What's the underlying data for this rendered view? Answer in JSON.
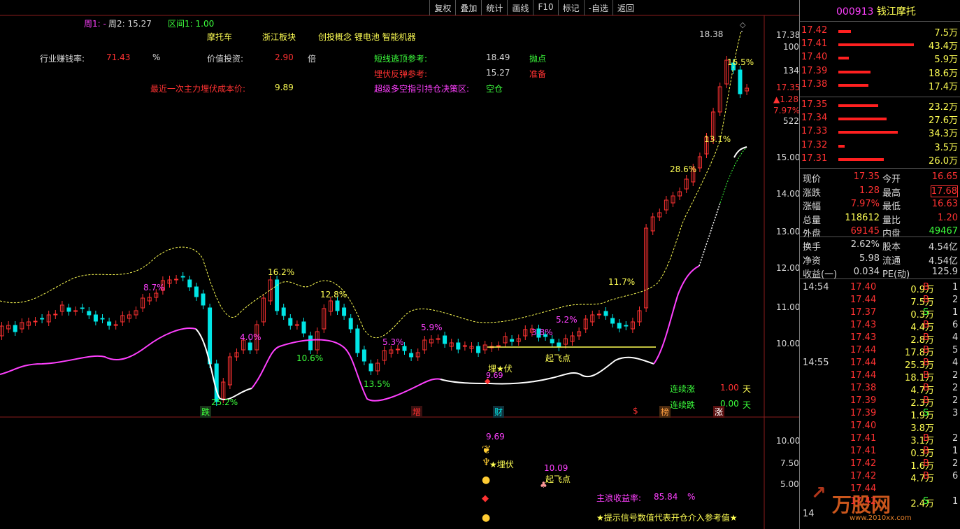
{
  "header": {
    "week1": "周1: -",
    "week2": "周2: 15.27",
    "range1": "区间1: 1.00"
  },
  "toolbar": [
    "复权",
    "叠加",
    "统计",
    "画线",
    "F10",
    "标记",
    "-自选",
    "返回"
  ],
  "info": {
    "tag1": "摩托车",
    "tag2": "浙江板块",
    "tag3": "创投概念 锂电池 智能机器",
    "industry_label": "行业赚钱率:",
    "industry_value": "71.43",
    "industry_unit": "%",
    "value_label": "价值投资:",
    "value_value": "2.90",
    "value_unit": "倍",
    "cost_label": "最近一次主力埋伏成本价:",
    "cost_value": "9.89",
    "short_top_label": "短线逃顶参考:",
    "short_top_value": "18.49",
    "short_top_action": "抛点",
    "rebound_label": "埋伏反弹参考:",
    "rebound_value": "15.27",
    "rebound_action": "准备",
    "super_label": "超级多空指引持仓决策区:",
    "super_value": "空仓",
    "consec_up_label": "连续涨",
    "consec_up_value": "1.00",
    "consec_up_unit": "天",
    "consec_down_label": "连续跌",
    "consec_down_value": "0.00",
    "consec_down_unit": "天"
  },
  "annotations": {
    "p87": "8.7%",
    "p162": "16.2%",
    "p128": "12.8%",
    "p40": "4.0%",
    "p106": "10.6%",
    "p53": "5.3%",
    "p135": "13.5%",
    "p59": "5.9%",
    "p38": "3.8%",
    "p52": "5.2%",
    "p117": "11.7%",
    "p286": "28.6%",
    "p131": "13.1%",
    "p165": "16.5%",
    "p252": "25.2%",
    "high_label": "18.38",
    "maifu": "埋★伏",
    "maifu_val": "9.69",
    "qifei": "起飞点",
    "sig_die": "跌",
    "sig_zeng": "增",
    "sig_cai": "财",
    "sig_s": "$",
    "sig_bang": "榜",
    "sig_zhang": "涨"
  },
  "price_axis": [
    "17.38",
    "100",
    "134",
    "17.35",
    "▲1.28",
    "7.97%",
    "522",
    "15.00",
    "14.00",
    "13.00",
    "12.00",
    "11.00",
    "10.00"
  ],
  "lower_axis": [
    "10.00",
    "7.50",
    "5.00"
  ],
  "lower": {
    "val1": "9.69",
    "maifu": "★埋伏",
    "val2": "10.09",
    "qifei": "起飞点",
    "profit_label": "主浪收益率:",
    "profit_value": "85.84",
    "profit_unit": "%",
    "note": "★提示信号数值代表开仓介入参考值★",
    "watermark": "万股网",
    "watermark_url": "www.2010xx.com"
  },
  "quote": {
    "code": "000913",
    "name": "钱江摩托",
    "asks": [
      {
        "price": "17.42",
        "vol": "7.5万",
        "ratio": 0.17
      },
      {
        "price": "17.41",
        "vol": "43.4万",
        "ratio": 1.0
      },
      {
        "price": "17.40",
        "vol": "5.9万",
        "ratio": 0.14
      },
      {
        "price": "17.39",
        "vol": "18.6万",
        "ratio": 0.43
      },
      {
        "price": "17.38",
        "vol": "17.4万",
        "ratio": 0.4
      }
    ],
    "bids": [
      {
        "price": "17.35",
        "vol": "23.2万",
        "ratio": 0.53
      },
      {
        "price": "17.34",
        "vol": "27.6万",
        "ratio": 0.64
      },
      {
        "price": "17.33",
        "vol": "34.3万",
        "ratio": 0.79
      },
      {
        "price": "17.32",
        "vol": "3.5万",
        "ratio": 0.08
      },
      {
        "price": "17.31",
        "vol": "26.0万",
        "ratio": 0.6
      }
    ],
    "stats": [
      [
        "现价",
        "17.35",
        "今开",
        "16.65"
      ],
      [
        "涨跌",
        "1.28",
        "最高",
        "17.68"
      ],
      [
        "涨幅",
        "7.97%",
        "最低",
        "16.63"
      ],
      [
        "总量",
        "118612",
        "量比",
        "1.20"
      ],
      [
        "外盘",
        "69145",
        "内盘",
        "49467"
      ]
    ],
    "stats2": [
      [
        "换手",
        "2.62%",
        "股本",
        "4.54亿"
      ],
      [
        "净资",
        "5.98",
        "流通",
        "4.54亿"
      ],
      [
        "收益(一)",
        "0.034",
        "PE(动)",
        "125.9"
      ]
    ],
    "ticks1_time": "14:54",
    "ticks1": [
      [
        "17.40",
        "0.9万",
        "B",
        "1"
      ],
      [
        "17.44",
        "7.5万",
        "B",
        "2"
      ],
      [
        "17.37",
        "0.3万",
        "S",
        "1"
      ],
      [
        "17.43",
        "4.4万",
        "B",
        "6"
      ],
      [
        "17.43",
        "2.8万",
        "B",
        "4"
      ],
      [
        "17.44",
        "17.8万",
        "B",
        "5"
      ]
    ],
    "ticks2_time": "14:55",
    "ticks2": [
      [
        "17.44",
        "25.3万",
        "B",
        "4"
      ],
      [
        "17.44",
        "18.1万",
        "B",
        "2"
      ],
      [
        "17.38",
        "4.7万",
        "B",
        "2"
      ],
      [
        "17.39",
        "2.3万",
        "B",
        "2"
      ],
      [
        "17.39",
        "1.9万",
        "S",
        "3"
      ],
      [
        "17.40",
        "3.8万",
        "",
        ""
      ],
      [
        "17.41",
        "3.1万",
        "B",
        "2"
      ],
      [
        "17.41",
        "0.3万",
        "B",
        "1"
      ],
      [
        "17.42",
        "1.6万",
        "B",
        "2"
      ],
      [
        "17.42",
        "4.7万",
        "B",
        "6"
      ],
      [
        "17.44",
        "",
        "",
        ""
      ],
      [
        "17.42",
        "2.4万",
        "S",
        "1"
      ]
    ],
    "ticks3_time": "14"
  },
  "colors": {
    "up": "#ff3232",
    "down": "#00e6e6",
    "yellow": "#ffff54",
    "magenta": "#ff40ff",
    "green": "#3cff3c"
  }
}
